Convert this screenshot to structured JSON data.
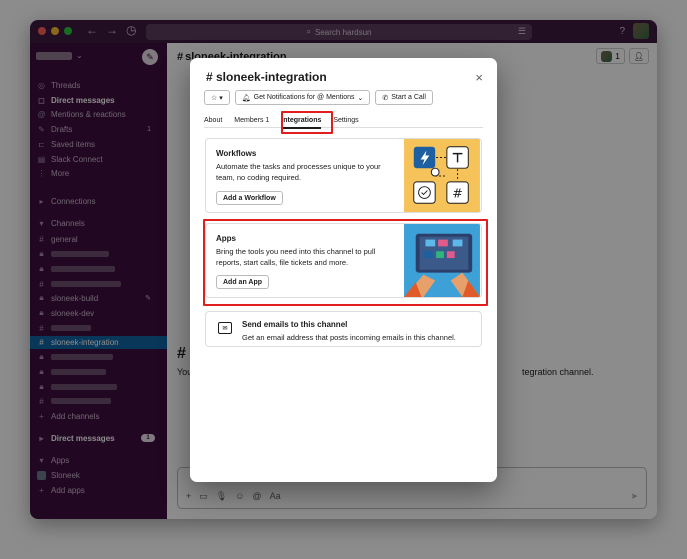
{
  "titlebar": {
    "search_placeholder": "Search hardsun",
    "help_icon": "help-icon"
  },
  "sidebar": {
    "top_items": [
      {
        "icon": "threads-icon",
        "label": "Threads"
      },
      {
        "icon": "dm-icon",
        "label": "Direct messages"
      },
      {
        "icon": "at-icon",
        "label": "Mentions & reactions"
      },
      {
        "icon": "drafts-icon",
        "label": "Drafts",
        "count": "1"
      },
      {
        "icon": "bookmark-icon",
        "label": "Saved items"
      },
      {
        "icon": "connect-icon",
        "label": "Slack Connect"
      },
      {
        "icon": "more-icon",
        "label": "More"
      }
    ],
    "connections_label": "Connections",
    "channels_label": "Channels",
    "channels": [
      {
        "label": "general"
      },
      {
        "label": ""
      },
      {
        "label": ""
      },
      {
        "label": ""
      },
      {
        "label": "sloneek-build"
      },
      {
        "label": "sloneek-dev"
      },
      {
        "label": ""
      },
      {
        "label": "sloneek-integration"
      },
      {
        "label": ""
      },
      {
        "label": ""
      },
      {
        "label": ""
      },
      {
        "label": ""
      }
    ],
    "add_channels": "Add channels",
    "dm_label": "Direct messages",
    "dm_count": "1",
    "apps_label": "Apps",
    "app_items": [
      {
        "label": "Sloneek"
      },
      {
        "label": "Add apps"
      }
    ],
    "bottom_label": "sloneek-integration"
  },
  "main": {
    "channel_name": "sloneek-integration",
    "member_count": "1",
    "bg_hash": "#",
    "bg_text_left": "You",
    "bg_text_right": "tegration channel."
  },
  "modal": {
    "title": "# sloneek-integration",
    "close_label": "×",
    "star_label": "☆ ▾",
    "notifications_label": "Get Notifications for @ Mentions",
    "call_label": "Start a Call",
    "tabs": [
      {
        "label": "About"
      },
      {
        "label": "Members 1"
      },
      {
        "label": "Integrations"
      },
      {
        "label": "Settings"
      }
    ],
    "workflows": {
      "title": "Workflows",
      "desc": "Automate the tasks and processes unique to your team, no coding required.",
      "button": "Add a Workflow"
    },
    "apps": {
      "title": "Apps",
      "desc": "Bring the tools you need into this channel to pull reports, start calls, file tickets and more.",
      "button": "Add an App"
    },
    "email": {
      "title": "Send emails to this channel",
      "desc": "Get an email address that posts incoming emails in this channel."
    }
  },
  "colors": {
    "sidebar": "#3f0e40",
    "titlebar": "#3c1b40",
    "selected": "#1264a3",
    "highlight": "#e01e1e",
    "workflow_bg": "#f6c35a",
    "apps_bg": "#3da1d8"
  }
}
